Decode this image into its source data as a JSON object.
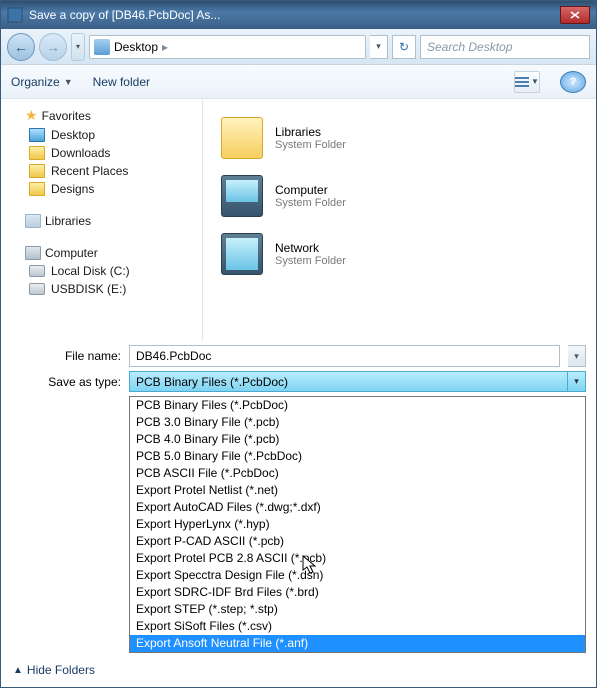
{
  "window": {
    "title": "Save a copy of [DB46.PcbDoc] As..."
  },
  "breadcrumb": {
    "location": "Desktop"
  },
  "search": {
    "placeholder": "Search Desktop"
  },
  "toolbar": {
    "organize": "Organize",
    "newfolder": "New folder"
  },
  "nav": {
    "favorites": "Favorites",
    "fav_items": [
      "Desktop",
      "Downloads",
      "Recent Places",
      "Designs"
    ],
    "libraries": "Libraries",
    "computer": "Computer",
    "comp_items": [
      "Local Disk (C:)",
      "USBDISK (E:)"
    ]
  },
  "content": {
    "items": [
      {
        "title": "Libraries",
        "sub": "System Folder",
        "kind": "folder"
      },
      {
        "title": "Computer",
        "sub": "System Folder",
        "kind": "pc"
      },
      {
        "title": "Network",
        "sub": "System Folder",
        "kind": "net"
      }
    ]
  },
  "form": {
    "filename_label": "File name:",
    "filename_value": "DB46.PcbDoc",
    "savetype_label": "Save as type:",
    "savetype_value": "PCB Binary Files (*.PcbDoc)"
  },
  "dropdown": {
    "options": [
      "PCB Binary Files (*.PcbDoc)",
      "PCB 3.0 Binary File (*.pcb)",
      "PCB 4.0 Binary File (*.pcb)",
      "PCB 5.0 Binary File (*.PcbDoc)",
      "PCB ASCII File (*.PcbDoc)",
      "Export Protel Netlist (*.net)",
      "Export AutoCAD Files (*.dwg;*.dxf)",
      "Export HyperLynx (*.hyp)",
      "Export P-CAD ASCII (*.pcb)",
      "Export Protel PCB 2.8 ASCII (*.pcb)",
      "Export Specctra Design File (*.dsn)",
      "Export SDRC-IDF Brd Files (*.brd)",
      "Export STEP (*.step; *.stp)",
      "Export SiSoft Files (*.csv)",
      "Export Ansoft Neutral File (*.anf)"
    ],
    "highlighted_index": 14
  },
  "bottom": {
    "hidefolders": "Hide Folders"
  }
}
